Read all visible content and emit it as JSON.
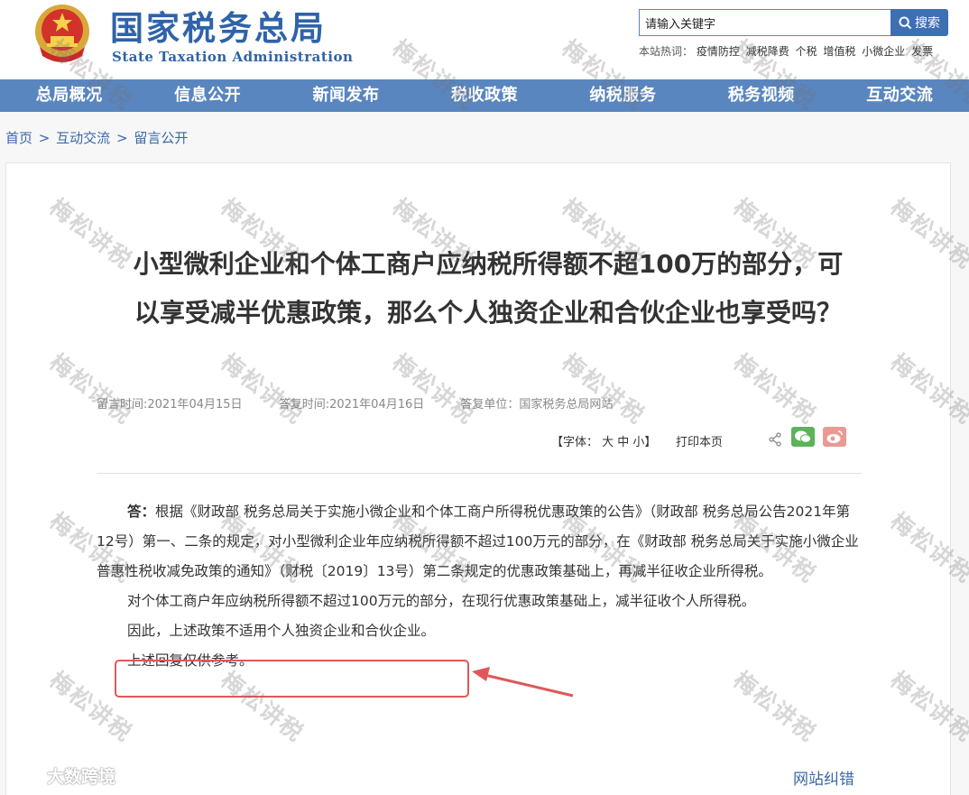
{
  "header": {
    "brand_cn": "国家税务总局",
    "brand_en": "State Taxation Administration",
    "search_placeholder": "请输入关键字",
    "search_button": "搜索",
    "hot_label": "本站热词：",
    "hot_words": [
      "疫情防控",
      "减税降费",
      "个税",
      "增值税",
      "小微企业",
      "发票"
    ]
  },
  "nav": [
    "总局概况",
    "信息公开",
    "新闻发布",
    "税收政策",
    "纳税服务",
    "税务视频",
    "互动交流"
  ],
  "breadcrumb": [
    "首页",
    "互动交流",
    "留言公开"
  ],
  "breadcrumb_sep": ">",
  "article": {
    "title": "小型微利企业和个体工商户应纳税所得额不超100万的部分，可以享受减半优惠政策，那么个人独资企业和合伙企业也享受吗？",
    "meta": [
      "留言时间:2021年04月15日",
      "答复时间:2021年04月16日",
      "答复单位：国家税务总局网站"
    ],
    "font_control": "【字体： 大 中 小】",
    "print": "打印本页",
    "answer_label": "答：",
    "paragraphs": [
      "根据《财政部 税务总局关于实施小微企业和个体工商户所得税优惠政策的公告》（财政部 税务总局公告2021年第12号）第一、二条的规定，对小型微利企业年应纳税所得额不超过100万元的部分，在《财政部 税务总局关于实施小微企业普惠性税收减免政策的通知》（财税〔2019〕13号）第二条规定的优惠政策基础上，再减半征收企业所得税。",
      "对个体工商户年应纳税所得额不超过100万元的部分，在现行优惠政策基础上，减半征收个人所得税。",
      "因此，上述政策不适用个人独资企业和合伙企业。",
      "上述回复仅供参考。"
    ],
    "error_link": "网站纠错"
  },
  "watermark": "梅松讲税",
  "corner_logo": "大数跨境",
  "colors": {
    "brand": "#2f63a9",
    "nav": "#5a86bf",
    "highlight": "#e0575a"
  }
}
